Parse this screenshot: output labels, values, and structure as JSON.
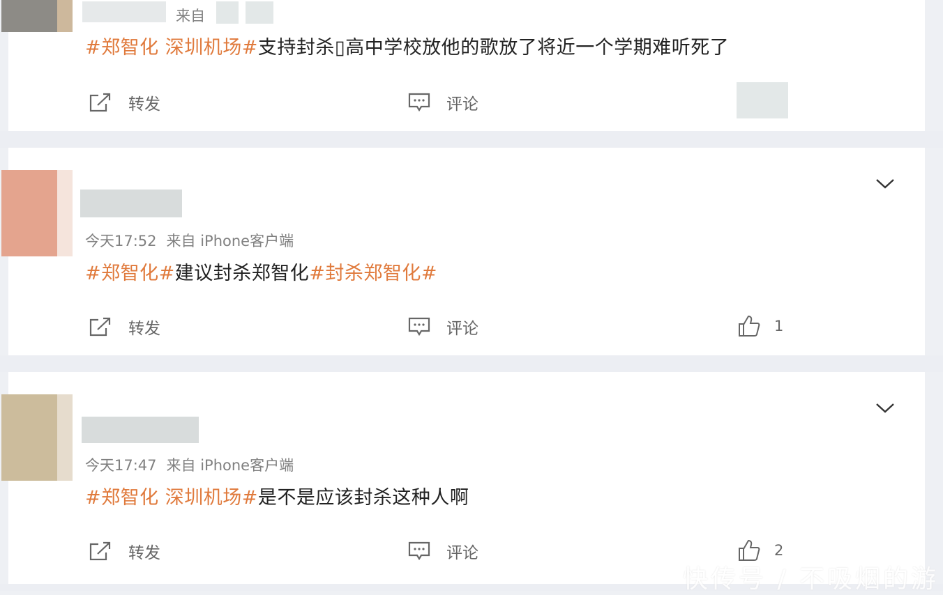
{
  "posts": [
    {
      "meta": {
        "source_prefix": "来自"
      },
      "text": {
        "tag1": "#郑智化 深圳机场#",
        "body": "支持封杀▯高中学校放他的歌放了将近一个学期难听死了"
      },
      "actions": {
        "repost": "转发",
        "comment": "评论"
      }
    },
    {
      "meta": {
        "time": "今天17:52",
        "source": "来自 iPhone客户端"
      },
      "text": {
        "tag1": "#郑智化#",
        "body": "建议封杀郑智化",
        "tag2": "#封杀郑智化#"
      },
      "actions": {
        "repost": "转发",
        "comment": "评论",
        "likes": "1"
      }
    },
    {
      "meta": {
        "time": "今天17:47",
        "source": "来自 iPhone客户端"
      },
      "text": {
        "tag1": "#郑智化 深圳机场#",
        "body": "是不是应该封杀这种人啊"
      },
      "actions": {
        "repost": "转发",
        "comment": "评论",
        "likes": "2"
      }
    }
  ],
  "watermark": "快传号 / 不吸烟的游",
  "colors": {
    "hashtag": "#e07a3c",
    "text": "#222222",
    "meta": "#808080",
    "background": "#eef0f4"
  }
}
